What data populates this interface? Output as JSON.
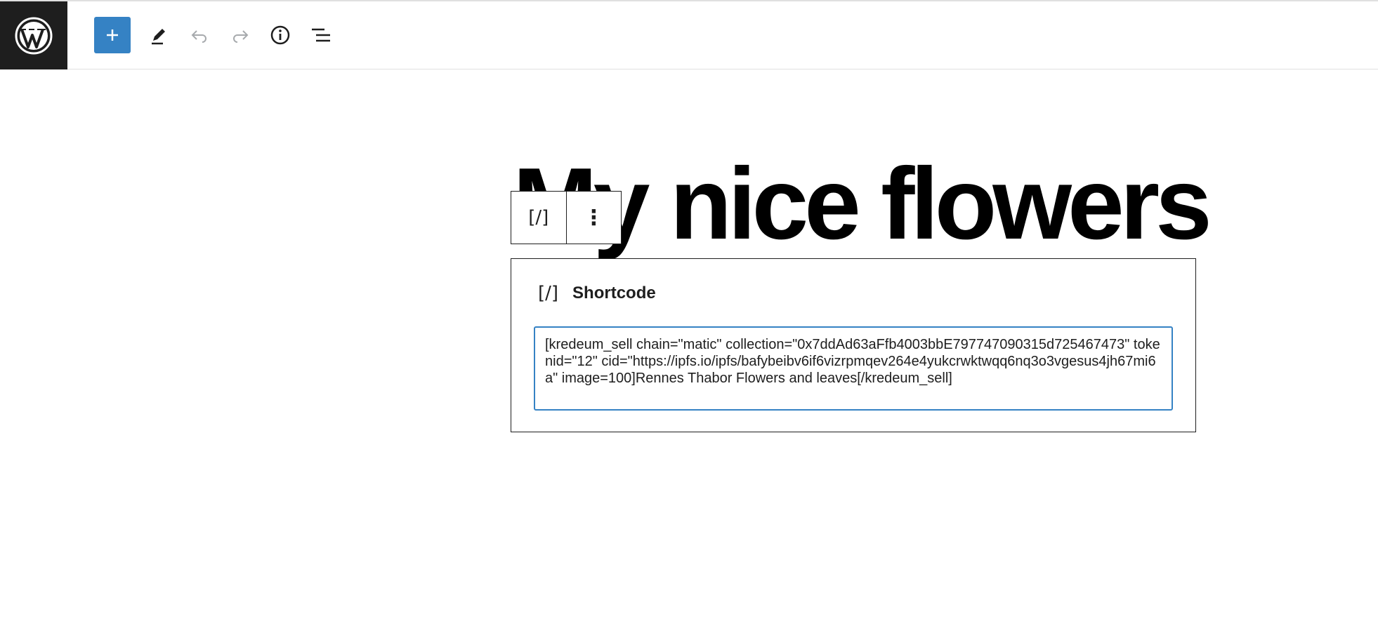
{
  "toolbar": {
    "logo_icon": "wordpress-logo-icon",
    "add_icon": "plus-icon",
    "tools_icon": "pencil-icon",
    "undo_icon": "undo-icon",
    "redo_icon": "redo-icon",
    "details_icon": "info-icon",
    "list_view_icon": "list-view-icon",
    "accent_color": "#3582c4"
  },
  "post": {
    "title": "My nice flowers"
  },
  "block_toolbar": {
    "block_type_glyph": "[/]",
    "options_glyph": "⋮"
  },
  "shortcode_block": {
    "icon_glyph": "[/]",
    "label": "Shortcode",
    "value": "[kredeum_sell chain=\"matic\" collection=\"0x7ddAd63aFfb4003bbE797747090315d725467473\" tokenid=\"12\" cid=\"https://ipfs.io/ipfs/bafybeibv6if6vizrpmqev264e4yukcrwktwqq6nq3o3vgesus4jh67mi6a\" image=100]Rennes Thabor Flowers and leaves[/kredeum_sell]"
  }
}
